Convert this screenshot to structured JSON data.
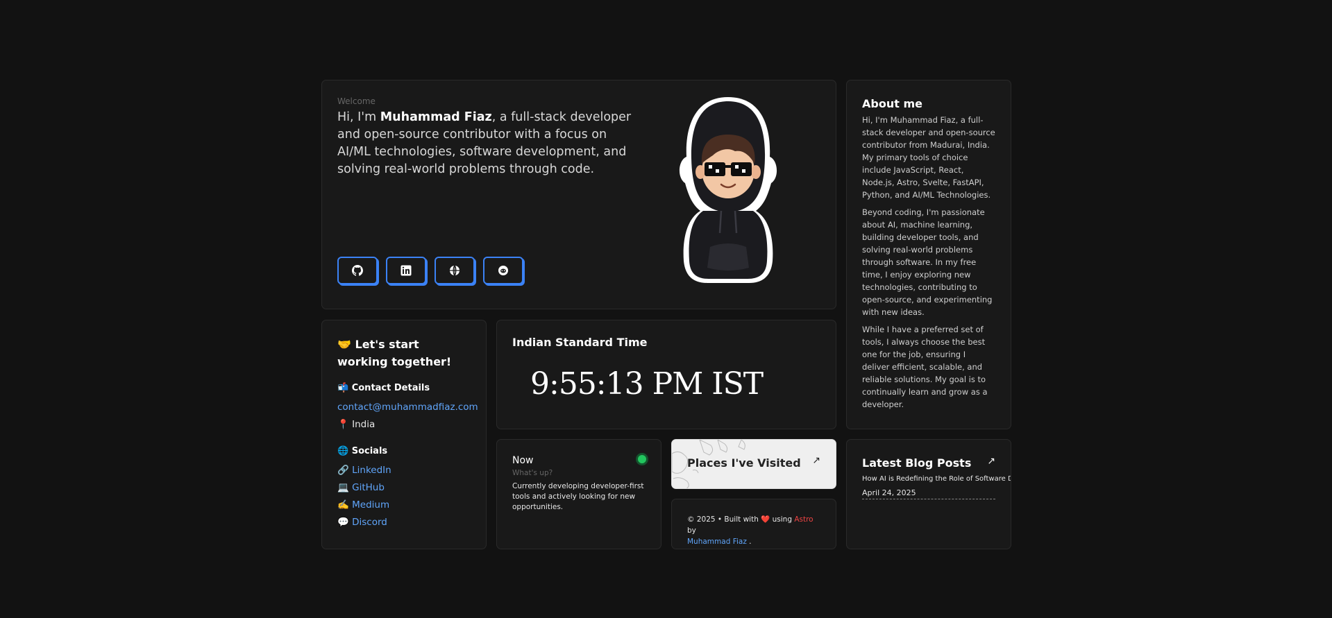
{
  "hero": {
    "welcome": "Welcome",
    "intro_prefix": "Hi, I'm ",
    "name": "Muhammad Fiaz",
    "intro_suffix": ", a full-stack developer and open-source contributor with a focus on AI/ML technologies, software development, and solving real-world problems through code.",
    "social_icons": [
      "github-icon",
      "linkedin-icon",
      "globe-icon",
      "discord-icon"
    ],
    "accent_color": "#3b82f6"
  },
  "about": {
    "title": "About me",
    "p1": "Hi, I'm Muhammad Fiaz, a full-stack developer and open-source contributor from Madurai, India. My primary tools of choice include JavaScript, React, Node.js, Astro, Svelte, FastAPI, Python, and AI/ML Technologies.",
    "p2": "Beyond coding, I'm passionate about AI, machine learning, building developer tools, and solving real-world problems through software. In my free time, I enjoy exploring new technologies, contributing to open-source, and experimenting with new ideas.",
    "p3": "While I have a preferred set of tools, I always choose the best one for the job, ensuring I deliver efficient, scalable, and reliable solutions. My goal is to continually learn and grow as a developer."
  },
  "contact": {
    "title": "🤝 Let's start working together!",
    "details_heading": "📬 Contact Details",
    "email": "contact@muhammadfiaz.com",
    "location": "📍 India",
    "socials_heading": "🌐 Socials",
    "socials": [
      {
        "emoji": "🔗",
        "label": "LinkedIn"
      },
      {
        "emoji": "💻",
        "label": "GitHub"
      },
      {
        "emoji": "✍️",
        "label": "Medium"
      },
      {
        "emoji": "💬",
        "label": "Discord"
      }
    ]
  },
  "time": {
    "title": "Indian Standard Time",
    "clock": "9:55:13 PM IST"
  },
  "now": {
    "title": "Now",
    "subtitle": "What's up?",
    "desc": "Currently developing developer-first tools and actively looking for new opportunities.",
    "status_color": "#22c55e"
  },
  "places": {
    "title": "Places I've Visited",
    "arrow": "↗"
  },
  "footer": {
    "prefix": "© 2025 • Built with ",
    "heart": "❤️",
    "middle": " using ",
    "astro": "Astro",
    "by": " by",
    "author": "Muhammad Fiaz",
    "end": " ."
  },
  "blog": {
    "title": "Latest Blog Posts",
    "arrow": "↗",
    "post_title": "How AI is Redefining the Role of Software Developers",
    "post_date": "April 24, 2025"
  }
}
